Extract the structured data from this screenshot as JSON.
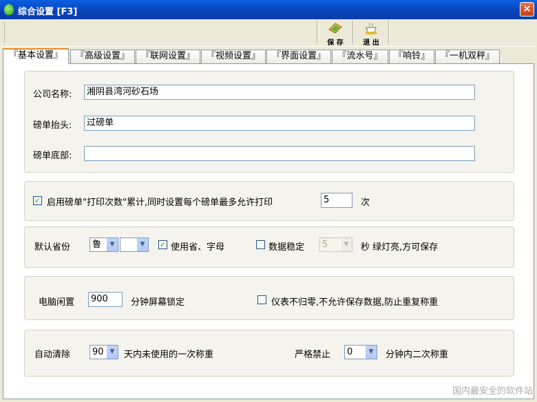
{
  "window": {
    "title": "综合设置 [F3]",
    "close_label": "×"
  },
  "toolbar": {
    "save_label": "保 存",
    "exit_label": "退 出"
  },
  "tabs": [
    {
      "label": "『基本设置』"
    },
    {
      "label": "『高级设置』"
    },
    {
      "label": "『联网设置』"
    },
    {
      "label": "『视频设置』"
    },
    {
      "label": "『界面设置』"
    },
    {
      "label": "『流水号』"
    },
    {
      "label": "『响铃』"
    },
    {
      "label": "『一机双秤』"
    }
  ],
  "company": {
    "name_label": "公司名称:",
    "name_value": "湘阴县湾河砂石场",
    "header_label": "磅单抬头:",
    "header_value": "过磅单",
    "footer_label": "磅单底部:",
    "footer_value": ""
  },
  "print_count": {
    "checked_mark": "✓",
    "label": "启用磅单\"打印次数\"累计,同时设置每个磅单最多允许打印",
    "value": "5",
    "unit": "次"
  },
  "province": {
    "label": "默认省份",
    "province_value": "鲁",
    "letter_value": "",
    "use_letter_checked_mark": "✓",
    "use_letter_label": "使用省、字母",
    "stable_checked_mark": "",
    "stable_label": "数据稳定",
    "stable_seconds": "5",
    "stable_suffix": "秒 绿灯亮,方可保存"
  },
  "idle": {
    "label": "电脑闲置",
    "value": "900",
    "suffix": "分钟屏幕锁定",
    "zero_checked_mark": "",
    "zero_label": "仪表不归零,不允许保存数据,防止重复称重"
  },
  "cleanup": {
    "label": "自动清除",
    "days_value": "90",
    "days_suffix": "天内未使用的一次称重",
    "forbid_label": "严格禁止",
    "forbid_value": "0",
    "forbid_suffix": "分钟内二次称重"
  },
  "watermark": {
    "text": "国内最安全的软件站"
  },
  "icons": {
    "arrow": "▼"
  }
}
